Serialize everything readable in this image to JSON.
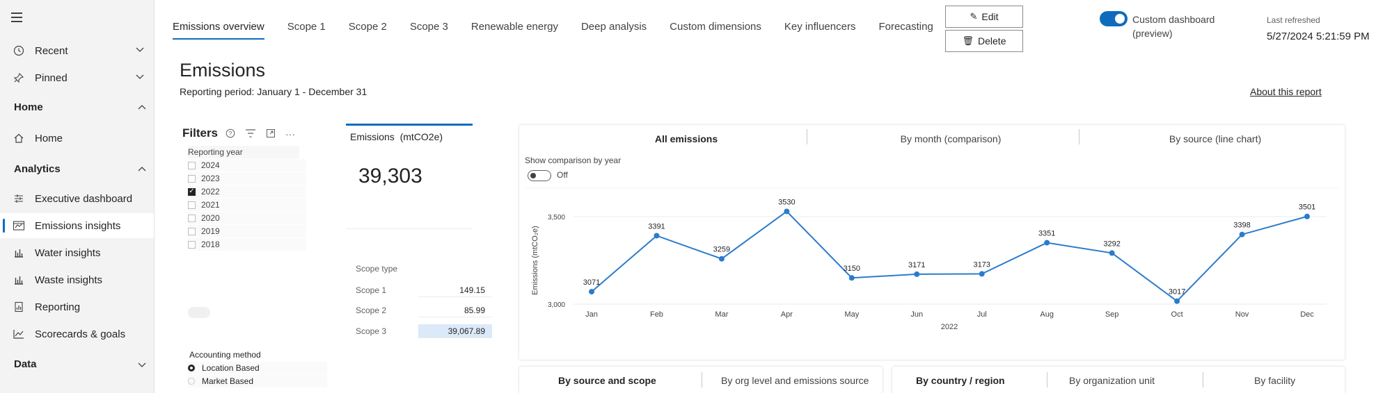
{
  "sidebar": {
    "items": [
      {
        "label": "Recent",
        "icon": "clock-icon"
      },
      {
        "label": "Pinned",
        "icon": "pin-icon"
      }
    ],
    "groups": {
      "home": "Home",
      "analytics": "Analytics",
      "data": "Data"
    },
    "home_items": [
      {
        "label": "Home",
        "icon": "home-icon"
      }
    ],
    "analytics_items": [
      {
        "label": "Executive dashboard",
        "icon": "dashboard-icon"
      },
      {
        "label": "Emissions insights",
        "icon": "emissions-chart-icon",
        "active": true
      },
      {
        "label": "Water insights",
        "icon": "bar-chart-icon"
      },
      {
        "label": "Waste insights",
        "icon": "bar-chart-icon"
      },
      {
        "label": "Reporting",
        "icon": "report-icon"
      },
      {
        "label": "Scorecards & goals",
        "icon": "trend-icon"
      }
    ]
  },
  "tabs": [
    "Emissions overview",
    "Scope 1",
    "Scope 2",
    "Scope 3",
    "Renewable energy",
    "Deep analysis",
    "Custom dimensions",
    "Key influencers",
    "Forecasting"
  ],
  "toolbar": {
    "edit_label": "Edit",
    "delete_label": "Delete"
  },
  "custom_dashboard": {
    "label_line1": "Custom dashboard",
    "label_line2": "(preview)",
    "enabled": true
  },
  "refresh": {
    "label": "Last refreshed",
    "value": "5/27/2024 5:21:59 PM"
  },
  "page": {
    "title": "Emissions",
    "period": "Reporting period: January 1 - December 31",
    "about_link": "About this report"
  },
  "filters": {
    "title": "Filters",
    "year_label": "Reporting year",
    "years": [
      {
        "label": "2024",
        "checked": false
      },
      {
        "label": "2023",
        "checked": false
      },
      {
        "label": "2022",
        "checked": true
      },
      {
        "label": "2021",
        "checked": false
      },
      {
        "label": "2020",
        "checked": false
      },
      {
        "label": "2019",
        "checked": false
      },
      {
        "label": "2018",
        "checked": false
      }
    ],
    "accounting_label": "Accounting method",
    "accounting_options": [
      {
        "label": "Location Based",
        "selected": true
      },
      {
        "label": "Market Based",
        "selected": false
      }
    ]
  },
  "emissions_card": {
    "title": "Emissions  (mtCO2e)",
    "total": "39,303",
    "scope_type_label": "Scope type",
    "scopes": [
      {
        "name": "Scope 1",
        "value": "149.15"
      },
      {
        "name": "Scope 2",
        "value": "85.99"
      },
      {
        "name": "Scope 3",
        "value": "39,067.89"
      }
    ]
  },
  "chart_tabs": [
    "All emissions",
    "By month (comparison)",
    "By source (line chart)"
  ],
  "comparison": {
    "label": "Show comparison by year",
    "state": "Off"
  },
  "chart_data": {
    "type": "line",
    "categories": [
      "Jan",
      "Feb",
      "Mar",
      "Apr",
      "May",
      "Jun",
      "Jul",
      "Aug",
      "Sep",
      "Oct",
      "Nov",
      "Dec"
    ],
    "values": [
      3071,
      3391,
      3259,
      3530,
      3150,
      3171,
      3173,
      3351,
      3292,
      3017,
      3398,
      3501
    ],
    "xlabel": "2022",
    "ylabel": "Emissions (mtCO₂e)",
    "ylim": [
      3000,
      3500
    ],
    "yticks": [
      "3,000",
      "3,500"
    ],
    "color": "#2b7bcc",
    "grid": true
  },
  "bottom_tabs_left": [
    "By source and scope",
    "By org level and emissions source"
  ],
  "bottom_tabs_right": [
    "By country / region",
    "By organization unit",
    "By facility"
  ]
}
